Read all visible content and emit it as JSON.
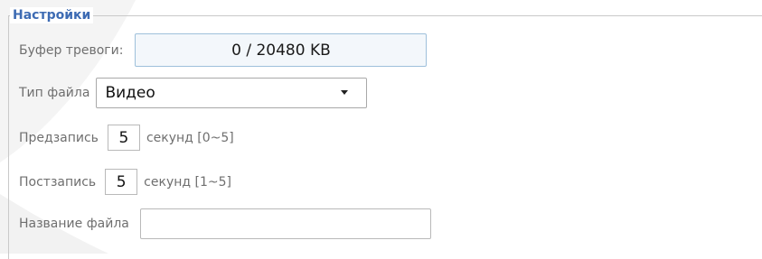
{
  "section": {
    "title": "Настройки"
  },
  "alarm_buffer": {
    "label": "Буфер тревоги:",
    "value": "0 / 20480 KB"
  },
  "file_type": {
    "label": "Тип файла",
    "selected": "Видео"
  },
  "pre_record": {
    "label": "Предзапись",
    "value": "5",
    "unit": "секунд [0~5]"
  },
  "post_record": {
    "label": "Постзапись",
    "value": "5",
    "unit": "секунд [1~5]"
  },
  "file_name": {
    "label": "Название файла",
    "value": ""
  },
  "icons": {
    "dropdown": "chevron-down-icon"
  },
  "colors": {
    "legend": "#3d6bb3",
    "label": "#6f6f6f",
    "buffer_border": "#9ec0db",
    "buffer_bg": "#f3f7fb"
  }
}
